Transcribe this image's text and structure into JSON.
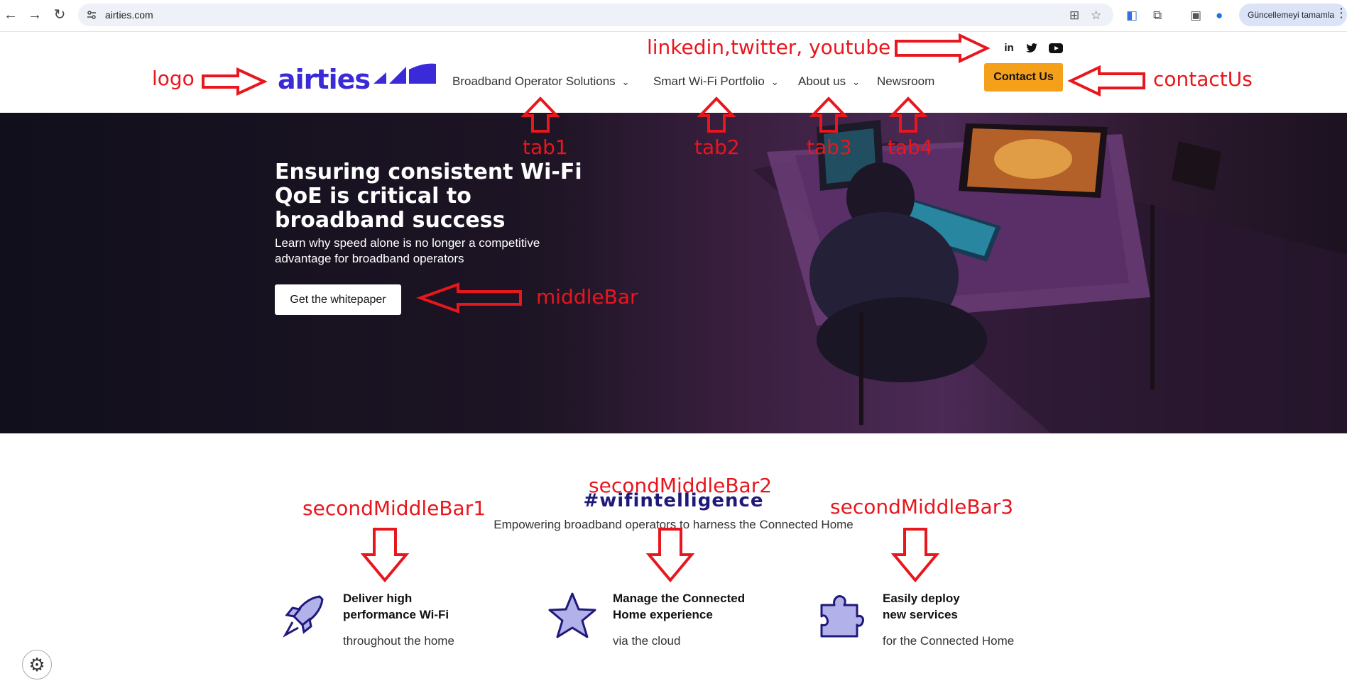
{
  "browser": {
    "url": "airties.com",
    "profile_label": "Güncellemeyi tamamla"
  },
  "header": {
    "logo_text": "airties",
    "nav": [
      {
        "label": "Broadband Operator Solutions"
      },
      {
        "label": "Smart Wi-Fi Portfolio"
      },
      {
        "label": "About us"
      },
      {
        "label": "Newsroom"
      }
    ],
    "contact_label": "Contact Us",
    "social": [
      "linkedin-icon",
      "twitter-icon",
      "youtube-icon"
    ]
  },
  "hero": {
    "title": "Ensuring consistent Wi-Fi QoE is critical to broadband success",
    "subtitle": "Learn why speed alone is no longer a competitive advantage for broadband operators",
    "cta_label": "Get the whitepaper"
  },
  "wifi": {
    "title": "#wifintelligence",
    "subtitle": "Empowering broadband operators to harness the Connected Home"
  },
  "features": [
    {
      "icon": "rocket-icon",
      "title1": "Deliver high",
      "title2": "performance Wi-Fi",
      "desc": "throughout the home"
    },
    {
      "icon": "star-icon",
      "title1": "Manage the Connected",
      "title2": "Home experience",
      "desc": "via the cloud"
    },
    {
      "icon": "puzzle-icon",
      "title1": "Easily deploy",
      "title2": "new services",
      "desc": "for the Connected Home"
    }
  ],
  "annotations": {
    "logo": "logo",
    "social": "linkedin,twitter, youtube",
    "contact": "contactUs",
    "tab1": "tab1",
    "tab2": "tab2",
    "tab3": "tab3",
    "tab4": "tab4",
    "middle": "middleBar",
    "second1": "secondMiddleBar1",
    "second2": "secondMiddleBar2",
    "second3": "secondMiddleBar3"
  },
  "colors": {
    "brand": "#3a2ad8",
    "contact_button": "#f5a01a",
    "annotation": "#e8161d",
    "wifi_title": "#1f1a7a"
  }
}
